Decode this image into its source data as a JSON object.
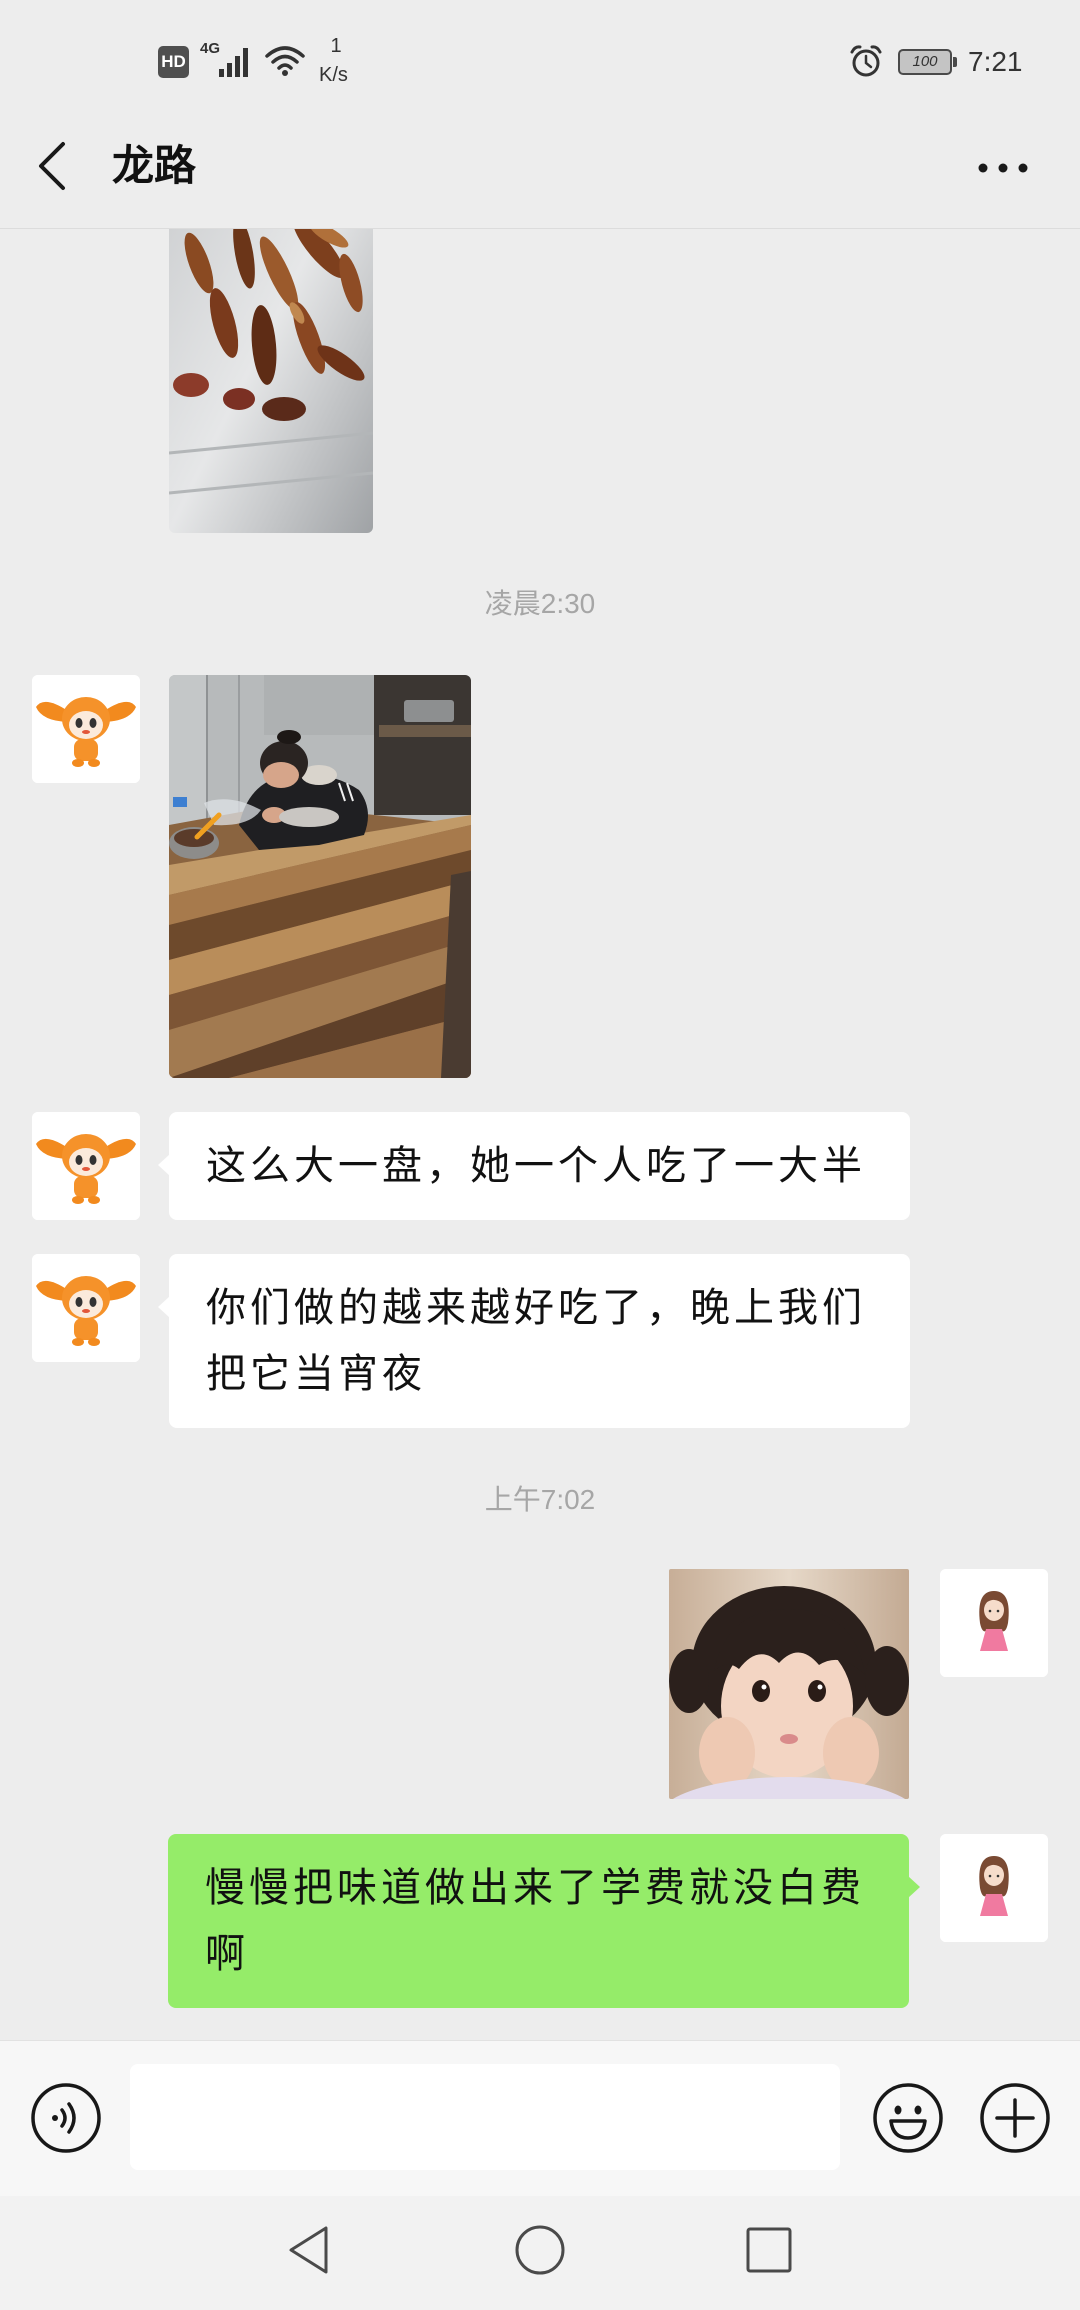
{
  "status_bar": {
    "hd_badge": "HD",
    "network_type": "4G",
    "net_speed_value": "1",
    "net_speed_unit": "K/s",
    "battery_level": "100",
    "time": "7:21",
    "icons": [
      "signal-icon",
      "wifi-icon",
      "alarm-icon",
      "battery-icon"
    ]
  },
  "header": {
    "title": "龙路",
    "icons": [
      "back-arrow-icon",
      "more-icon"
    ]
  },
  "chat": {
    "timestamps": [
      "凌晨2:30",
      "上午7:02"
    ],
    "incoming_texts": [
      "这么大一盘，她一个人吃了一大半",
      "你们做的越来越好吃了，晚上我们把它当宵夜"
    ],
    "outgoing_texts": [
      "慢慢把味道做出来了学费就没白费啊"
    ]
  },
  "input_bar": {
    "value": "",
    "icons": [
      "voice-icon",
      "emoji-icon",
      "plus-icon"
    ]
  },
  "nav_bar": {
    "icons": [
      "nav-back-icon",
      "nav-home-icon",
      "nav-recents-icon"
    ]
  },
  "colors": {
    "background": "#ededed",
    "incoming_bubble": "#ffffff",
    "outgoing_bubble": "#95ec69",
    "timestamp_text": "#a6a6a6",
    "input_bar": "#f7f7f7",
    "nav_bar": "#f2f2f2"
  }
}
